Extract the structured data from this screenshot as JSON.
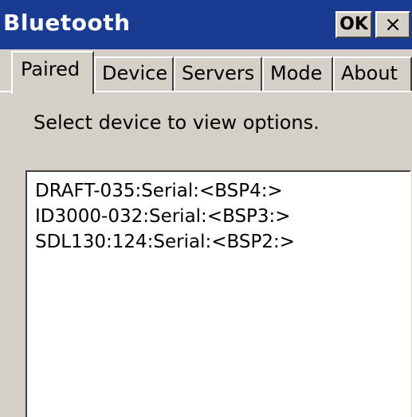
{
  "window": {
    "title": "Bluetooth",
    "ok_label": "OK",
    "close_label": "×"
  },
  "tabs": [
    {
      "label": "Paired",
      "active": true
    },
    {
      "label": "Device",
      "active": false
    },
    {
      "label": "Servers",
      "active": false
    },
    {
      "label": "Mode",
      "active": false
    },
    {
      "label": "About",
      "active": false
    }
  ],
  "instruction": "Select device to view options.",
  "devices": [
    "DRAFT-035:Serial:<BSP4:>",
    "ID3000-032:Serial:<BSP3:>",
    "SDL130:124:Serial:<BSP2:>"
  ],
  "colors": {
    "titlebar": "#1a3b92",
    "face": "#d4d0c8",
    "list_background": "#ffffff"
  }
}
